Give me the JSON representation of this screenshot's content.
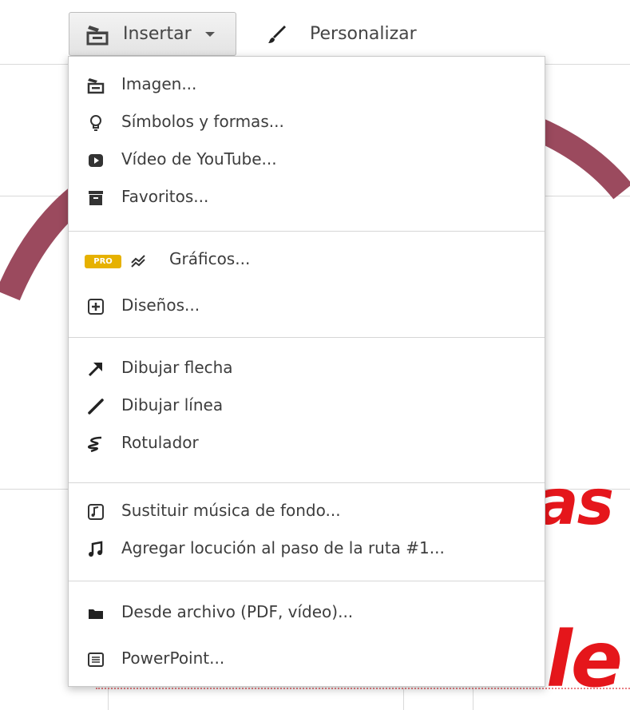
{
  "toolbar": {
    "insert_label": "Insertar",
    "personalize_label": "Personalizar"
  },
  "menu": {
    "groups": [
      {
        "items": [
          {
            "label": "Imagen...",
            "icon": "image-icon"
          },
          {
            "label": "Símbolos y formas...",
            "icon": "lightbulb-icon"
          },
          {
            "label": "Vídeo de YouTube...",
            "icon": "youtube-icon"
          },
          {
            "label": "Favoritos...",
            "icon": "archive-icon"
          }
        ]
      },
      {
        "items": [
          {
            "label": "Gráficos...",
            "icon": "chart-icon",
            "badge": "PRO"
          },
          {
            "label": "Diseños...",
            "icon": "plus-square-icon"
          }
        ]
      },
      {
        "items": [
          {
            "label": "Dibujar flecha",
            "icon": "arrow-icon"
          },
          {
            "label": "Dibujar línea",
            "icon": "line-icon"
          },
          {
            "label": "Rotulador",
            "icon": "marker-icon"
          }
        ]
      },
      {
        "items": [
          {
            "label": "Sustituir música de fondo...",
            "icon": "music-file-icon"
          },
          {
            "label": "Agregar locución al paso de la ruta #1...",
            "icon": "music-note-icon"
          }
        ]
      },
      {
        "items": [
          {
            "label": "Desde archivo (PDF, vídeo)...",
            "icon": "folder-icon"
          },
          {
            "label": "PowerPoint...",
            "icon": "list-icon"
          }
        ]
      }
    ]
  },
  "background": {
    "text_top": "as",
    "text_bottom": "le",
    "arc_color": "#9b4a5e",
    "text_color": "#e5161b"
  },
  "colors": {
    "pro_badge": "#e6b100"
  }
}
